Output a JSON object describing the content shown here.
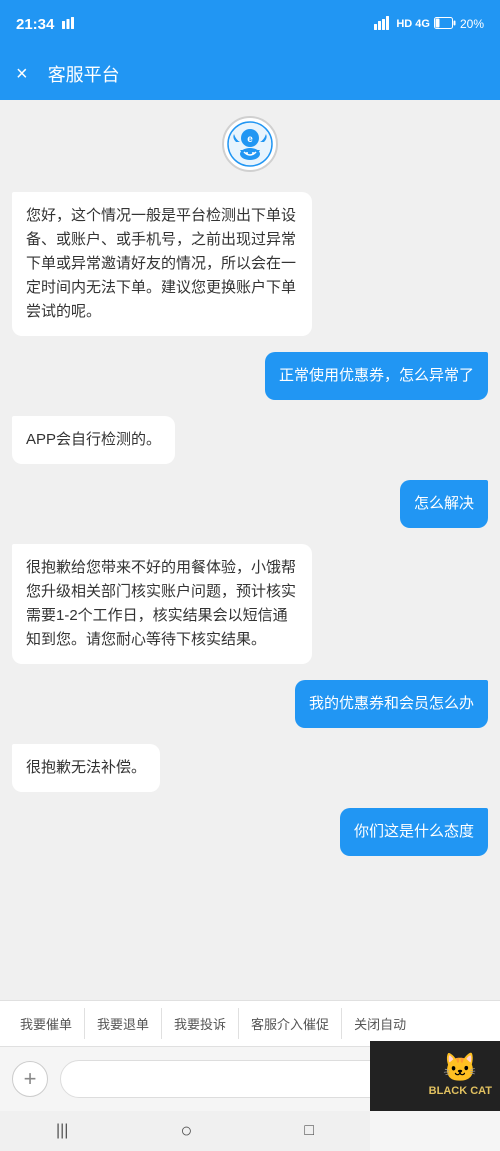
{
  "statusBar": {
    "time": "21:34",
    "battery": "20%",
    "signal": "4G"
  },
  "header": {
    "closeLabel": "×",
    "title": "客服平台"
  },
  "messages": [
    {
      "id": 1,
      "type": "bot",
      "text": "您好，这个情况一般是平台检测出下单设备、或账户、或手机号，之前出现过异常下单或异常邀请好友的情况，所以会在一定时间内无法下单。建议您更换账户下单尝试的呢。"
    },
    {
      "id": 2,
      "type": "user",
      "text": "正常使用优惠券，怎么异常了"
    },
    {
      "id": 3,
      "type": "bot",
      "text": "APP会自行检测的。"
    },
    {
      "id": 4,
      "type": "user",
      "text": "怎么解决"
    },
    {
      "id": 5,
      "type": "bot",
      "text": "很抱歉给您带来不好的用餐体验，小饿帮您升级相关部门核实账户问题，预计核实需要1-2个工作日，核实结果会以短信通知到您。请您耐心等待下核实结果。"
    },
    {
      "id": 6,
      "type": "user",
      "text": "我的优惠券和会员怎么办"
    },
    {
      "id": 7,
      "type": "bot",
      "text": "很抱歉无法补偿。"
    },
    {
      "id": 8,
      "type": "user",
      "text": "你们这是什么态度"
    }
  ],
  "quickReplies": [
    "我要催单",
    "我要退单",
    "我要投诉",
    "客服介入催促",
    "关闭自动"
  ],
  "inputBar": {
    "placeholder": "",
    "plusLabel": "+",
    "sendLabel": "↑"
  },
  "watermark": {
    "brand": "BLACK CAT",
    "logo": "🐱"
  },
  "navBar": {
    "back": "|||",
    "home": "○",
    "recent": "□"
  }
}
